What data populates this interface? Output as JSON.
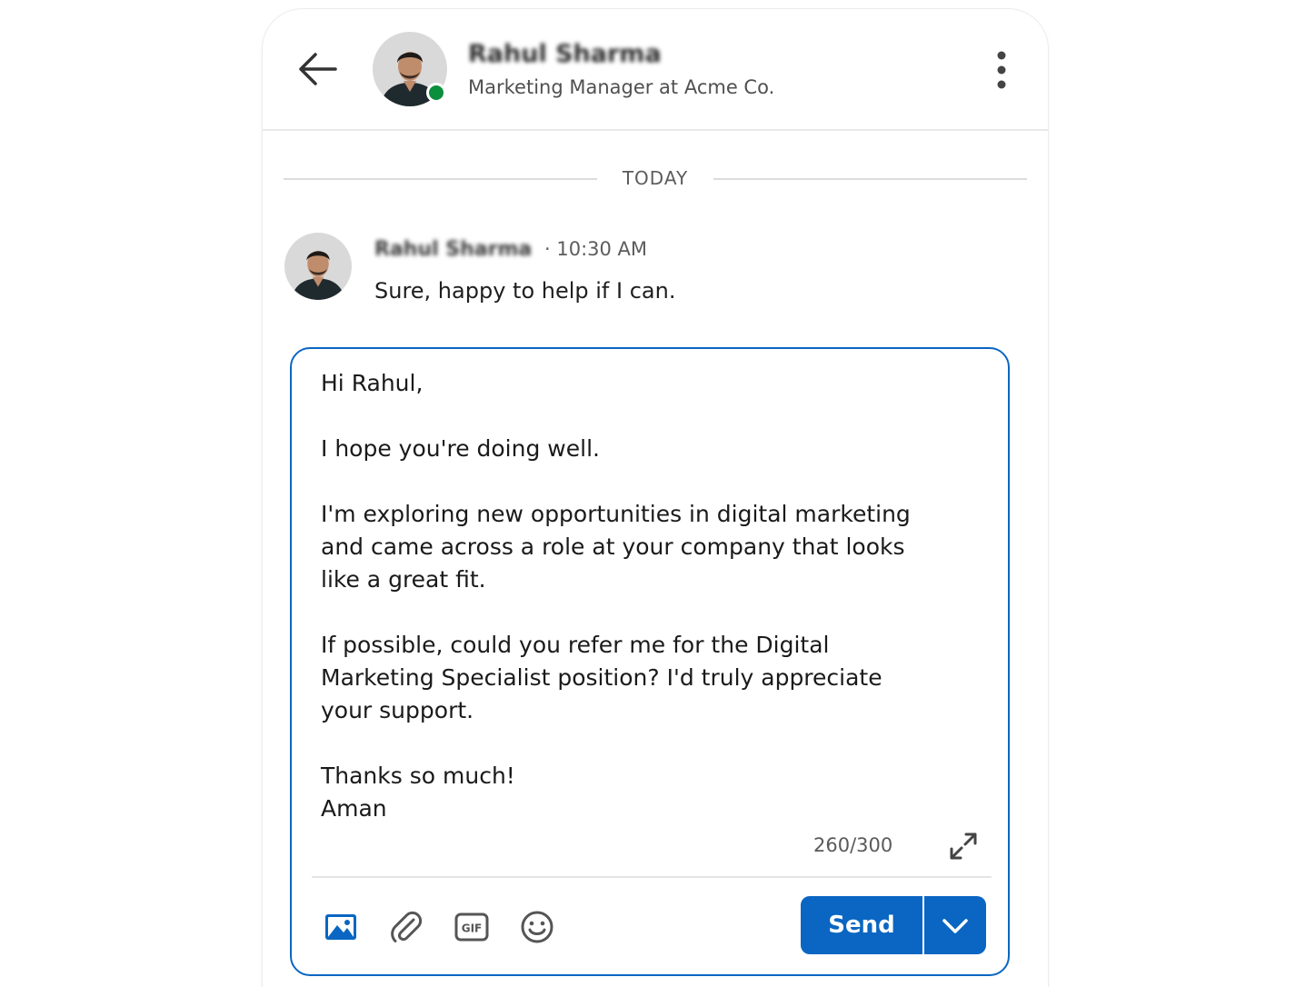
{
  "header": {
    "contact_name": "Rahul Sharma",
    "contact_title": "Marketing Manager at Acme Co.",
    "online": true
  },
  "conversation": {
    "day_label": "TODAY",
    "message": {
      "sender": "Rahul Sharma",
      "time": "· 10:30 AM",
      "text": "Sure, happy to help if I can."
    }
  },
  "composer": {
    "text": "Hi Rahul,\n\nI hope you're doing well.\n\nI'm exploring new opportunities in digital marketing\nand came across a role at your company that looks\nlike a great fit.\n\nIf possible, could you refer me for the Digital\nMarketing Specialist position? I'd truly appreciate\nyour support.\n\nThanks so much!\nAman",
    "char_count": "260/300",
    "send_label": "Send"
  },
  "colors": {
    "accent": "#0a66c2",
    "presence": "#0a8f3c"
  },
  "icons": {
    "back": "arrow-left-icon",
    "more": "more-vertical-icon",
    "expand": "expand-icon",
    "image": "image-icon",
    "attach": "paperclip-icon",
    "gif": "gif-icon",
    "emoji": "emoji-icon",
    "dropdown": "chevron-down-icon"
  }
}
